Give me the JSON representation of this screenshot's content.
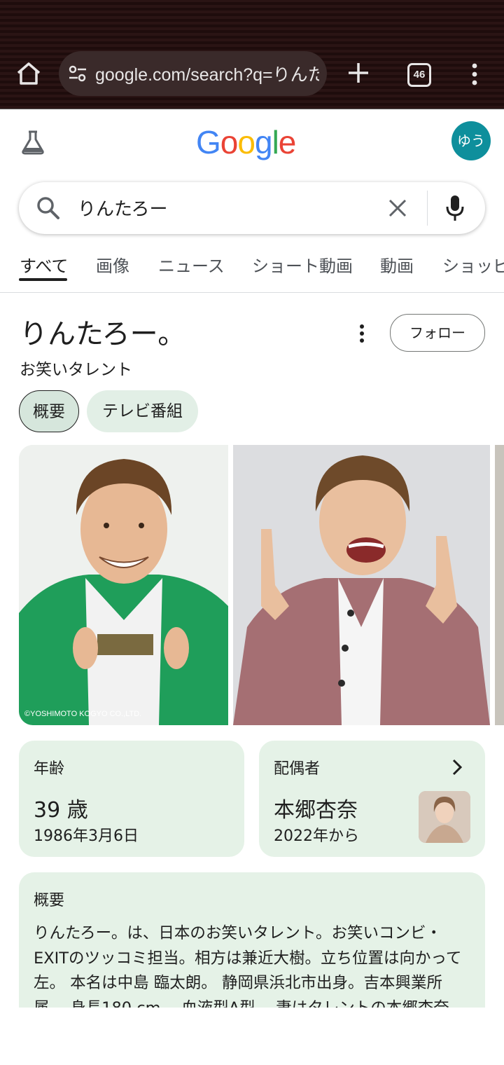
{
  "browser": {
    "url": "google.com/search?q=りんたろー",
    "tab_count": "46"
  },
  "header": {
    "logo": [
      "G",
      "o",
      "o",
      "g",
      "l",
      "e"
    ],
    "logo_colors": [
      "#4285F4",
      "#EA4335",
      "#FBBC05",
      "#4285F4",
      "#34A853",
      "#EA4335"
    ],
    "avatar_text": "ゆう",
    "avatar_color": "#0e8f9c"
  },
  "search": {
    "query": "りんたろー"
  },
  "tabs": [
    {
      "label": "すべて",
      "active": true
    },
    {
      "label": "画像"
    },
    {
      "label": "ニュース"
    },
    {
      "label": "ショート動画"
    },
    {
      "label": "動画"
    },
    {
      "label": "ショッピング"
    }
  ],
  "knowledge_panel": {
    "title": "りんたろー。",
    "subtitle": "お笑いタレント",
    "follow_label": "フォロー",
    "chips": [
      "概要",
      "テレビ番組"
    ],
    "photo_caption": "©YOSHIMOTO KOGYO CO.,LTD.",
    "age": {
      "label": "年齢",
      "value": "39 歳",
      "detail": "1986年3月6日"
    },
    "spouse": {
      "label": "配偶者",
      "value": "本郷杏奈",
      "detail": "2022年から"
    },
    "overview": {
      "label": "概要",
      "text": "りんたろー。は、日本のお笑いタレント。お笑いコンビ・EXITのツッコミ担当。相方は兼近大樹。立ち位置は向かって左。 本名は中島 臨太朗。 静岡県浜北市出身。吉本興業所属。 身長180 cm 、血液型A型。 妻はタレントの本郷杏奈。"
    }
  }
}
